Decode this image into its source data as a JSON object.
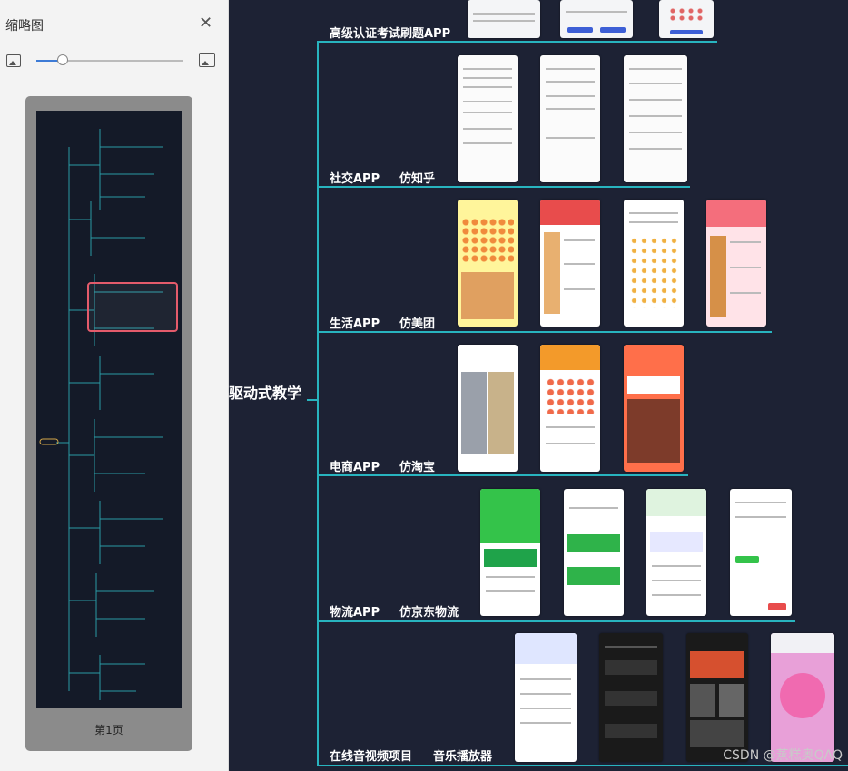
{
  "sidebar": {
    "title": "缩略图",
    "page_label": "第1页",
    "zoom_level": 0.18
  },
  "mindmap": {
    "central": "驱动式教学",
    "branches": [
      {
        "category": "高级认证考试刷题APP",
        "sub": ""
      },
      {
        "category": "社交APP",
        "sub": "仿知乎"
      },
      {
        "category": "生活APP",
        "sub": "仿美团"
      },
      {
        "category": "电商APP",
        "sub": "仿淘宝"
      },
      {
        "category": "物流APP",
        "sub": "仿京东物流"
      },
      {
        "category": "在线音视频项目",
        "sub": "音乐播放器"
      }
    ]
  },
  "watermark": "CSDN @蒸糕奥QAQ",
  "colors": {
    "line": "#28b4bf",
    "canvas": "#1d2234",
    "viewport": "#e45b6b",
    "accent": "#3d7bd6"
  }
}
